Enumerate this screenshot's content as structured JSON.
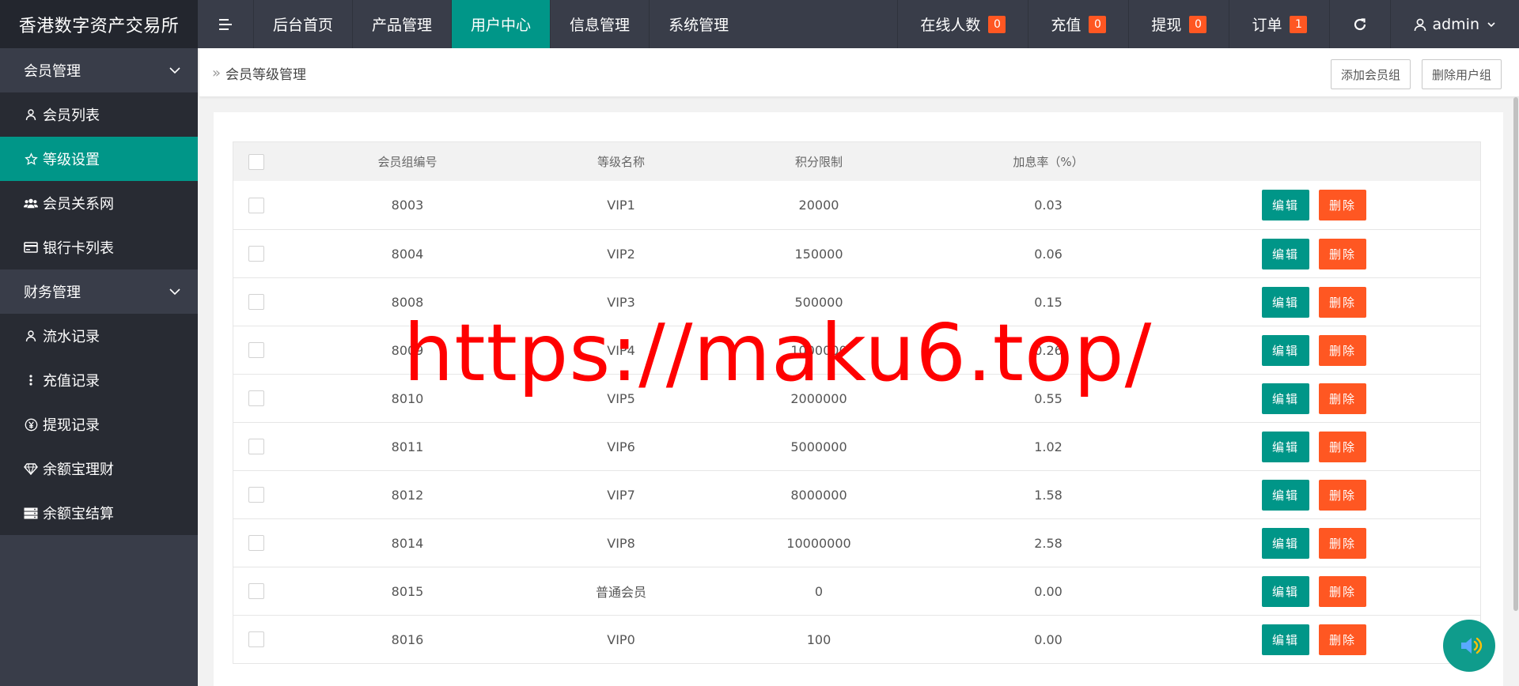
{
  "app": {
    "title": "香港数字资产交易所"
  },
  "header": {
    "nav": [
      {
        "label": "后台首页"
      },
      {
        "label": "产品管理"
      },
      {
        "label": "用户中心"
      },
      {
        "label": "信息管理"
      },
      {
        "label": "系统管理"
      }
    ],
    "stats": [
      {
        "label": "在线人数",
        "count": "0"
      },
      {
        "label": "充值",
        "count": "0"
      },
      {
        "label": "提现",
        "count": "0"
      },
      {
        "label": "订单",
        "count": "1"
      }
    ],
    "user": "admin"
  },
  "sidebar": {
    "groups": [
      {
        "label": "会员管理",
        "items": [
          {
            "label": "会员列表",
            "icon": "user-icon"
          },
          {
            "label": "等级设置",
            "icon": "star-icon"
          },
          {
            "label": "会员关系网",
            "icon": "users-icon"
          },
          {
            "label": "银行卡列表",
            "icon": "card-icon"
          }
        ]
      },
      {
        "label": "财务管理",
        "items": [
          {
            "label": "流水记录",
            "icon": "user-icon"
          },
          {
            "label": "充值记录",
            "icon": "dots-icon"
          },
          {
            "label": "提现记录",
            "icon": "yen-icon"
          },
          {
            "label": "余额宝理财",
            "icon": "diamond-icon"
          },
          {
            "label": "余额宝结算",
            "icon": "server-icon"
          }
        ]
      }
    ]
  },
  "breadcrumb": {
    "current": "会员等级管理"
  },
  "actions": {
    "add_group": "添加会员组",
    "delete_group": "删除用户组"
  },
  "table": {
    "headers": {
      "id": "会员组编号",
      "name": "等级名称",
      "points": "积分限制",
      "rate": "加息率（%）"
    },
    "edit_label": "编辑",
    "delete_label": "删除",
    "rows": [
      {
        "id": "8003",
        "name": "VIP1",
        "points": "20000",
        "rate": "0.03"
      },
      {
        "id": "8004",
        "name": "VIP2",
        "points": "150000",
        "rate": "0.06"
      },
      {
        "id": "8008",
        "name": "VIP3",
        "points": "500000",
        "rate": "0.15"
      },
      {
        "id": "8009",
        "name": "VIP4",
        "points": "1000000",
        "rate": "0.26"
      },
      {
        "id": "8010",
        "name": "VIP5",
        "points": "2000000",
        "rate": "0.55"
      },
      {
        "id": "8011",
        "name": "VIP6",
        "points": "5000000",
        "rate": "1.02"
      },
      {
        "id": "8012",
        "name": "VIP7",
        "points": "8000000",
        "rate": "1.58"
      },
      {
        "id": "8014",
        "name": "VIP8",
        "points": "10000000",
        "rate": "2.58"
      },
      {
        "id": "8015",
        "name": "普通会员",
        "points": "0",
        "rate": "0.00"
      },
      {
        "id": "8016",
        "name": "VIP0",
        "points": "100",
        "rate": "0.00"
      }
    ]
  },
  "watermark": "https://maku6.top/",
  "colors": {
    "primary": "#009688",
    "danger": "#ff5722",
    "header_bg": "#393d49",
    "sidebar_dark": "#282b33",
    "watermark": "#ff0000"
  }
}
